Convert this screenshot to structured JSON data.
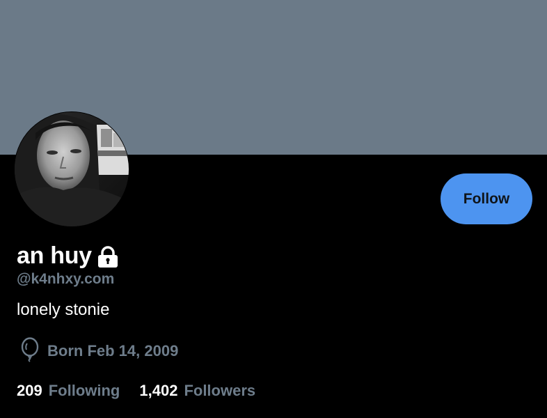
{
  "profile": {
    "display_name": "an huy",
    "handle": "@k4nhxy.com",
    "bio": "lonely stonie",
    "born": "Born Feb 14, 2009",
    "follow_label": "Follow",
    "protected_icon": "lock-icon",
    "birthday_icon": "balloon-icon"
  },
  "stats": {
    "following_count": "209",
    "following_label": "Following",
    "followers_count": "1,402",
    "followers_label": "Followers"
  },
  "colors": {
    "banner": "#6b7a88",
    "background": "#000000",
    "follow_button": "#4d94f0",
    "secondary_text": "#6e7d8b"
  }
}
